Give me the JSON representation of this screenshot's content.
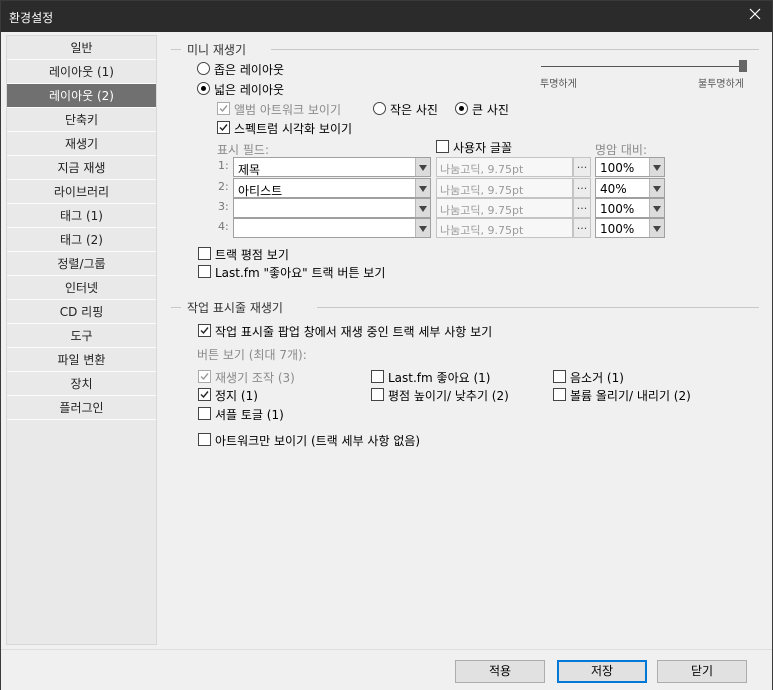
{
  "window": {
    "title": "환경설정"
  },
  "sidebar": {
    "selected": "레이아웃 (2)",
    "items": [
      "일반",
      "레이아웃 (1)",
      "레이아웃 (2)",
      "단축키",
      "재생기",
      "지금 재생",
      "라이브러리",
      "태그 (1)",
      "태그 (2)",
      "정렬/그룹",
      "인터넷",
      "CD 리핑",
      "도구",
      "파일 변환",
      "장치",
      "플러그인"
    ]
  },
  "mini_player": {
    "section_title": "미니 재생기",
    "narrow_layout": {
      "label": "좁은 레이아웃",
      "selected": false
    },
    "wide_layout": {
      "label": "넓은 레이아웃",
      "selected": true
    },
    "slider": {
      "left_label": "투명하게",
      "right_label": "불투명하게",
      "value": 1.0
    },
    "show_album_art": {
      "label": "앨범 아트워크 보이기",
      "checked": true,
      "enabled": false
    },
    "small_photo": {
      "label": "작은 사진",
      "selected": false
    },
    "large_photo": {
      "label": "큰 사진",
      "selected": true
    },
    "show_spectrum": {
      "label": "스펙트럼 시각화 보이기",
      "checked": true
    },
    "display_field_label": "표시 필드:",
    "user_font": {
      "label": "사용자 글꼴",
      "checked": false
    },
    "contrast_label": "명암 대비:",
    "fields": [
      {
        "num": "1:",
        "value": "제목",
        "font": "나눔고딕, 9.75pt",
        "contrast": "100%"
      },
      {
        "num": "2:",
        "value": "아티스트",
        "font": "나눔고딕, 9.75pt",
        "contrast": "40%"
      },
      {
        "num": "3:",
        "value": "",
        "font": "나눔고딕, 9.75pt",
        "contrast": "100%"
      },
      {
        "num": "4:",
        "value": "",
        "font": "나눔고딕, 9.75pt",
        "contrast": "100%"
      }
    ],
    "dots_label": "...",
    "show_track_rating": {
      "label": "트랙 평점 보기",
      "checked": false
    },
    "show_lastfm_like": {
      "label": "Last.fm \"좋아요\" 트랙 버튼 보기",
      "checked": false
    }
  },
  "taskbar_player": {
    "section_title": "작업 표시줄 재생기",
    "show_details": {
      "label": "작업 표시줄 팝업 창에서 재생 중인 트랙 세부 사항 보기",
      "checked": true
    },
    "buttons_label": "버튼 보기 (최대 7개):",
    "buttons": [
      {
        "label": "재생기 조작 (3)",
        "checked": true,
        "enabled": false
      },
      {
        "label": "Last.fm 좋아요 (1)",
        "checked": false,
        "enabled": true
      },
      {
        "label": "음소거 (1)",
        "checked": false,
        "enabled": true
      },
      {
        "label": "정지 (1)",
        "checked": true,
        "enabled": true
      },
      {
        "label": "평점 높이기/ 낮추기 (2)",
        "checked": false,
        "enabled": true
      },
      {
        "label": "볼륨 올리기/ 내리기 (2)",
        "checked": false,
        "enabled": true
      },
      {
        "label": "셔플 토글 (1)",
        "checked": false,
        "enabled": true
      }
    ],
    "artwork_only": {
      "label": "아트워크만 보이기 (트랙 세부 사항 없음)",
      "checked": false
    }
  },
  "footer": {
    "apply": "적용",
    "save": "저장",
    "close": "닫기"
  }
}
